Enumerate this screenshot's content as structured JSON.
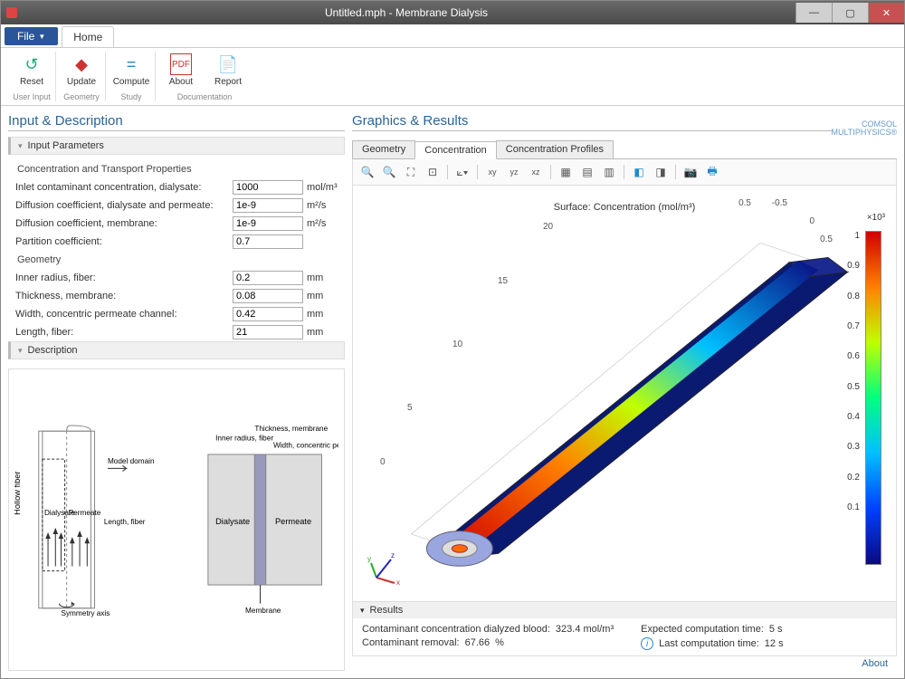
{
  "window": {
    "title": "Untitled.mph - Membrane Dialysis"
  },
  "menu": {
    "file": "File",
    "home": "Home"
  },
  "ribbon": {
    "reset": "Reset",
    "update": "Update",
    "compute": "Compute",
    "about": "About",
    "report": "Report",
    "grp_user": "User Input",
    "grp_geom": "Geometry",
    "grp_study": "Study",
    "grp_doc": "Documentation"
  },
  "left": {
    "title": "Input & Description",
    "params_head": "Input Parameters",
    "grp1": "Concentration and Transport Properties",
    "grp2": "Geometry",
    "desc_head": "Description",
    "fields": {
      "c_in": {
        "label": "Inlet contaminant concentration, dialysate:",
        "value": "1000",
        "unit": "mol/m³"
      },
      "d_dp": {
        "label": "Diffusion coefficient, dialysate and permeate:",
        "value": "1e-9",
        "unit": "m²/s"
      },
      "d_m": {
        "label": "Diffusion coefficient, membrane:",
        "value": "1e-9",
        "unit": "m²/s"
      },
      "k": {
        "label": "Partition coefficient:",
        "value": "0.7",
        "unit": ""
      },
      "r_in": {
        "label": "Inner radius, fiber:",
        "value": "0.2",
        "unit": "mm"
      },
      "t_m": {
        "label": "Thickness, membrane:",
        "value": "0.08",
        "unit": "mm"
      },
      "w_p": {
        "label": "Width, concentric permeate channel:",
        "value": "0.42",
        "unit": "mm"
      },
      "l_f": {
        "label": "Length, fiber:",
        "value": "21",
        "unit": "mm"
      }
    },
    "diagram": {
      "hollow_fiber": "Hollow fiber",
      "dialysate": "Dialysate",
      "permeate": "Permeate",
      "sym": "Symmetry axis",
      "model_domain": "Model domain",
      "inner_r": "Inner radius, fiber",
      "thick": "Thickness, membrane",
      "width": "Width, concentric permeate channel",
      "length": "Length, fiber",
      "membrane": "Membrane"
    }
  },
  "right": {
    "title": "Graphics & Results",
    "brand1": "COMSOL",
    "brand2": "MULTIPHYSICS®",
    "tabs": {
      "geom": "Geometry",
      "conc": "Concentration",
      "prof": "Concentration Profiles"
    },
    "plot_title": "Surface: Concentration (mol/m³)",
    "cb_exp": "×10³",
    "cb_ticks": [
      "1",
      "0.9",
      "0.8",
      "0.7",
      "0.6",
      "0.5",
      "0.4",
      "0.3",
      "0.2",
      "0.1"
    ],
    "ax_top": [
      "0.5",
      "-0.5",
      "0",
      "0.5"
    ],
    "ax_left": [
      "20",
      "15",
      "10",
      "5",
      "0"
    ],
    "tri": {
      "x": "x",
      "y": "y",
      "z": "z"
    }
  },
  "results": {
    "head": "Results",
    "c_out_l": "Contaminant concentration dialyzed blood:",
    "c_out_v": "323.4 mol/m³",
    "rem_l": "Contaminant removal:",
    "rem_v": "67.66",
    "rem_u": "%",
    "exp_l": "Expected computation time:",
    "exp_v": "5 s",
    "last_l": "Last computation time:",
    "last_v": "12 s"
  },
  "foot": {
    "about": "About"
  }
}
